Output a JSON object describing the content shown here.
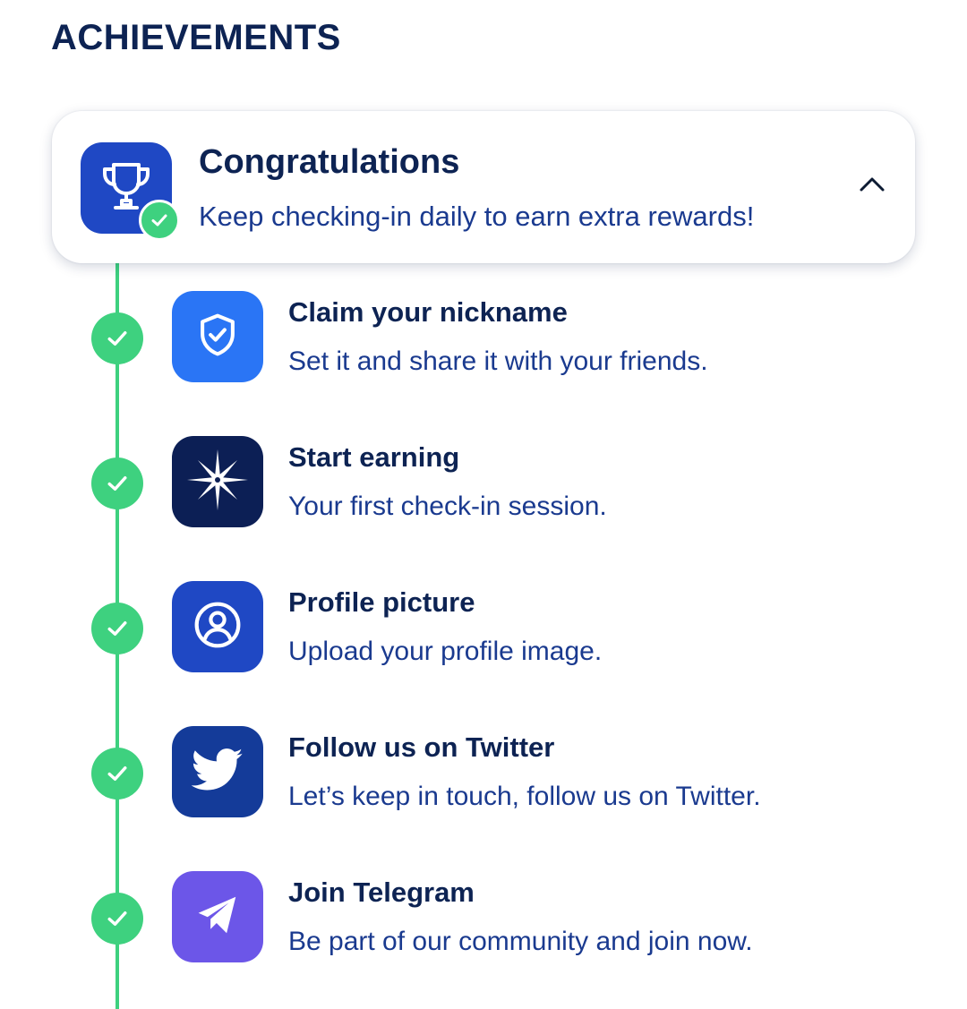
{
  "section": {
    "title": "ACHIEVEMENTS"
  },
  "summary": {
    "title": "Congratulations",
    "subtitle": "Keep checking-in daily to earn extra rewards!",
    "icon": "trophy-icon",
    "expanded": true
  },
  "achievements": [
    {
      "title": "Claim your nickname",
      "description": "Set it and share it with your friends.",
      "icon": "shield-check-icon",
      "icon_bg": "#2a75f5",
      "completed": true
    },
    {
      "title": "Start earning",
      "description": "Your first check-in session.",
      "icon": "compass-star-icon",
      "icon_bg": "#0c1f55",
      "completed": true
    },
    {
      "title": "Profile picture",
      "description": "Upload your profile image.",
      "icon": "user-circle-icon",
      "icon_bg": "#1f48c4",
      "completed": true
    },
    {
      "title": "Follow us on Twitter",
      "description": "Let’s keep in touch, follow us on Twitter.",
      "icon": "twitter-icon",
      "icon_bg": "#143b99",
      "completed": true
    },
    {
      "title": "Join Telegram",
      "description": "Be part of our community and join now.",
      "icon": "telegram-icon",
      "icon_bg": "#6c56e8",
      "completed": true
    }
  ],
  "colors": {
    "heading": "#0d2353",
    "body_text": "#1a3a8f",
    "success": "#3ed17f"
  }
}
